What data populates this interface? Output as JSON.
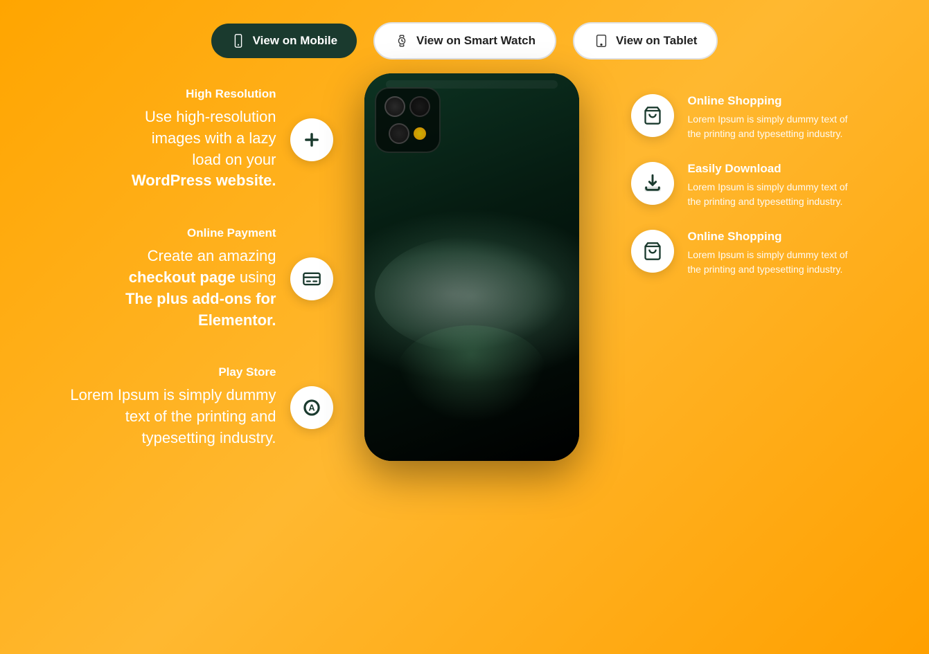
{
  "nav": {
    "mobile_label": "View on Mobile",
    "smartwatch_label": "View on Smart Watch",
    "tablet_label": "View on Tablet"
  },
  "left_features": [
    {
      "id": "high-res",
      "title": "High Resolution",
      "desc_line1": "Use high-resolution",
      "desc_line2": "images with a lazy",
      "desc_line3": "load on your",
      "desc_bold": "WordPress website.",
      "icon": "plus"
    },
    {
      "id": "online-payment",
      "title": "Online Payment",
      "desc_line1": "Create an amazing",
      "desc_bold1": "checkout page",
      "desc_line2": " using",
      "desc_bold2": "The plus add-ons for",
      "desc_bold3": "Elementor.",
      "icon": "payment"
    },
    {
      "id": "play-store",
      "title": "Play Store",
      "desc": "Lorem Ipsum is simply dummy text of the printing and typesetting industry.",
      "icon": "playstore"
    }
  ],
  "right_features": [
    {
      "id": "online-shopping-1",
      "title": "Online Shopping",
      "desc": "Lorem Ipsum is simply dummy text of the printing and typesetting industry.",
      "icon": "bag"
    },
    {
      "id": "easily-download",
      "title": "Easily Download",
      "desc": "Lorem Ipsum is simply dummy text of the printing and typesetting industry.",
      "icon": "download"
    },
    {
      "id": "online-shopping-2",
      "title": "Online Shopping",
      "desc": "Lorem Ipsum is simply dummy text of the printing and typesetting industry.",
      "icon": "bag"
    }
  ],
  "colors": {
    "bg_gradient_start": "#FFA500",
    "bg_gradient_end": "#FFB830",
    "dark_btn": "#1a3a2e",
    "white": "#ffffff"
  }
}
